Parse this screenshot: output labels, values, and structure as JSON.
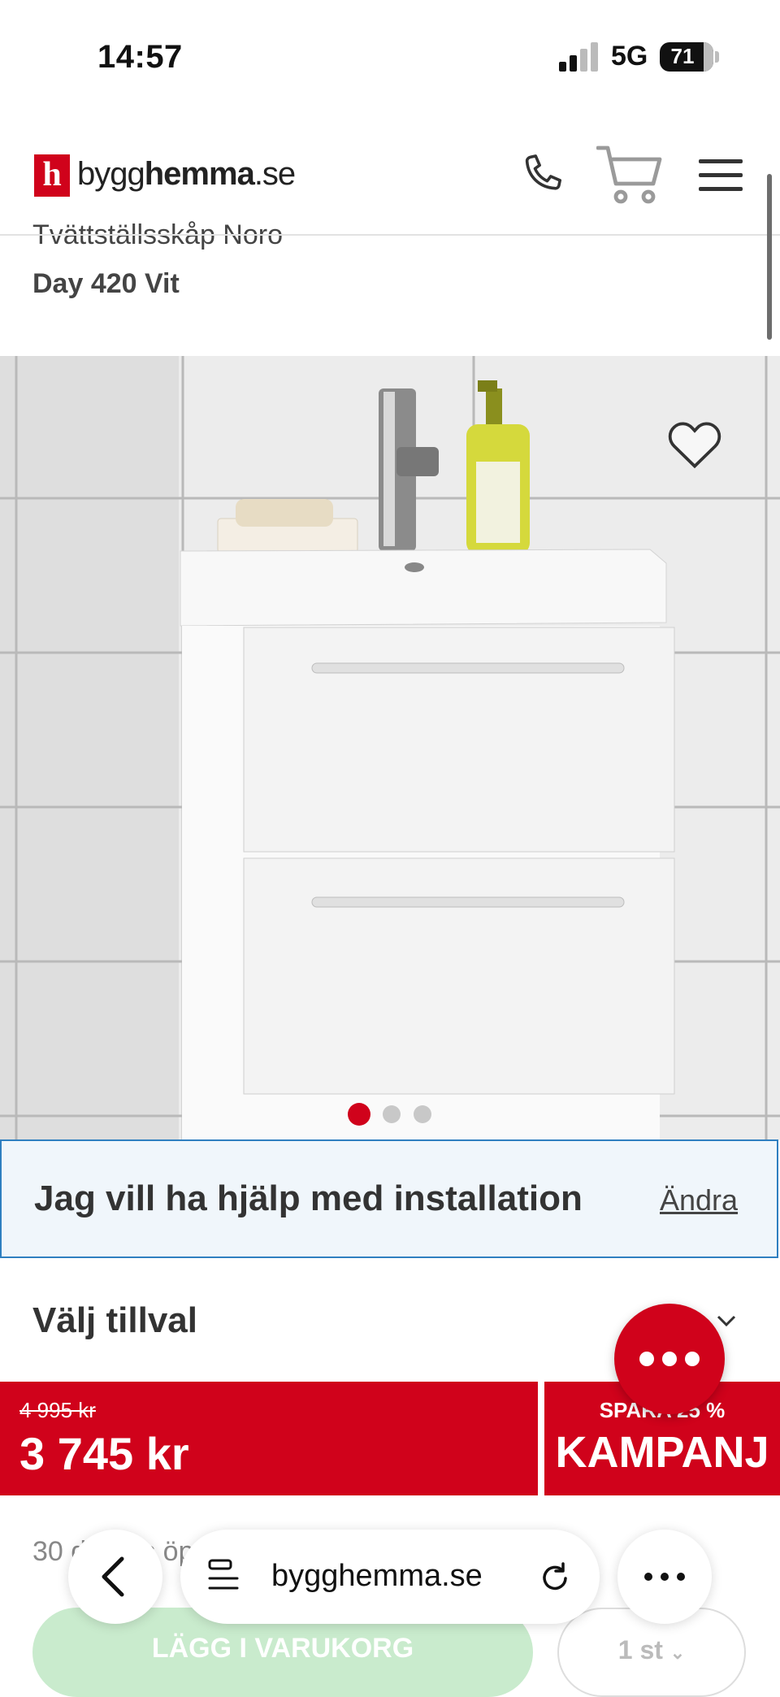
{
  "status_bar": {
    "time": "14:57",
    "network": "5G",
    "battery": "71",
    "battery_level": 0.71
  },
  "header": {
    "logo_letter": "h",
    "logo_pre": "bygg",
    "logo_bold": "hemma",
    "logo_post": ".se"
  },
  "product": {
    "title_line1": "Tvättställsskåp Noro",
    "title_line2": "Day 420 Vit",
    "image_count": 3,
    "active_image": 1
  },
  "install": {
    "text": "Jag vill ha hjälp med installation",
    "change_label": "Ändra"
  },
  "options": {
    "label": "Välj tillval"
  },
  "price": {
    "old": "4 995 kr",
    "current": "3 745 kr",
    "saving": "SPARA 25 %",
    "campaign": "KAMPANJ"
  },
  "delivery": {
    "text": "30 dagars öppet köp"
  },
  "cart": {
    "add_label": "LÄGG I VARUKORG",
    "quantity": "1 st"
  },
  "browser": {
    "url": "bygghemma.se"
  },
  "colors": {
    "brand_red": "#d0021b",
    "install_border": "#2f7fc0",
    "add_button": "#c9ebcd"
  }
}
